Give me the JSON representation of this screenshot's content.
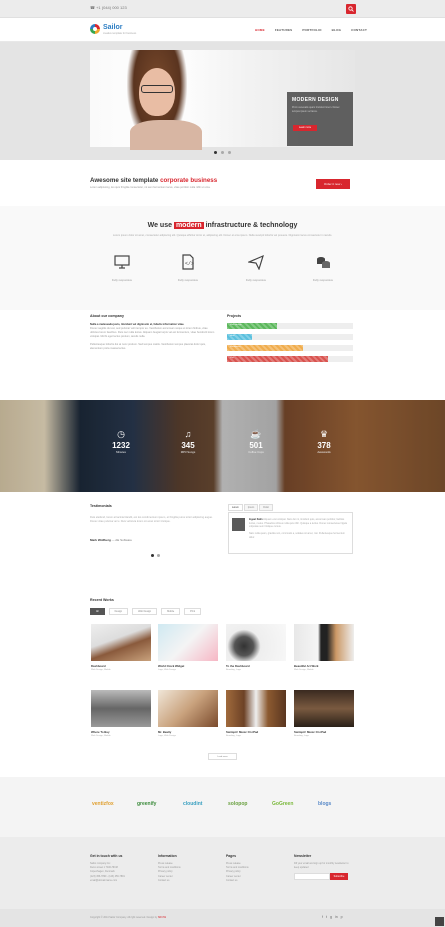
{
  "topbar": {
    "phone": "☎ +1 (044) 000 123",
    "search_icon": "search-icon"
  },
  "brand": {
    "name": "Sailor",
    "tagline": "creative template for business"
  },
  "nav": [
    "HOME",
    "FEATURES",
    "PORTFOLIO",
    "BLOG",
    "CONTACT"
  ],
  "hero": {
    "title": "MODERN DESIGN",
    "text": "Proin venenatis quam tincidunt lorem. Donec tempus ipsum vel lacus.",
    "button": "Learn more"
  },
  "promo": {
    "title_start": "Awesome site template",
    "title_highlight": "corporate business",
    "sub": "Lorem adipiscing, leo quis fringilla consectetur, mi sem fermentum lacus, vitae porttitor nulla nibh ut urna.",
    "button": "Order it now ›"
  },
  "tech": {
    "title_start": "We use",
    "title_highlight": "modern",
    "title_end": "infrastructure & technology",
    "sub": "Lorem ipsum dolor sit amet, consectetur adipiscing elit. Quisque efficitur tortor et, adipiscing elit. Donec et eros ipsum. Nulla suscipit lobortis vel posuere. Dignissim lacus consectetur in iaculis.",
    "features": [
      "Fully responsive",
      "Fully responsive",
      "Fully responsive",
      "Fully responsive"
    ]
  },
  "about": {
    "title": "About our company",
    "lead": "Nulla a malesuada justo, tincidunt vel dignissim et, fabulis information vitae.",
    "text": "Donec sagittis dui est, sed pulvinar velit tempor eu. Vestibulum accumsan neque et lorem finibus, vitae ultricies lorem faucibus. Duis nec nulla lectus. Aliquam feugiat turpis vel est fermentum, vitae hendrerit lorem volutpat. Morbi eget lectus pretium, iaculis nulla.",
    "text2": "Pellentesque lobortis dui at nunc pretium. Sed tempus mattis. Vestibulum tempus placerat dolor quis, elementum porta massa lectus."
  },
  "projects": {
    "title": "Projects",
    "bars": [
      {
        "label": "Web design",
        "value": 40,
        "color": "#5cb85c"
      },
      {
        "label": "Html",
        "value": 20,
        "color": "#5bc0de"
      },
      {
        "label": "Wordpress",
        "value": 60,
        "color": "#f0ad4e"
      },
      {
        "label": "Php",
        "value": 80,
        "color": "#d9534f"
      }
    ]
  },
  "stats": [
    {
      "icon": "clock-icon",
      "num": "1232",
      "label": "Minutes"
    },
    {
      "icon": "music-icon",
      "num": "345",
      "label": "MP3 Songs"
    },
    {
      "icon": "coffee-icon",
      "num": "501",
      "label": "Coffee Cups"
    },
    {
      "icon": "trophy-icon",
      "num": "378",
      "label": "Awwwards"
    }
  ],
  "testimonials": {
    "title": "Testimonials",
    "quote": "Duis eleifend, lorem at lacinia blandit, est leo condimentum ipsum, et fringilla purus tortor adipiscing augue. Donec vitae pulvinar arcu. Duis vehicula lorem sit amet tortor tristique.",
    "author": "Mark Wolfberg",
    "company": "AE Software",
    "tabs": [
      "Lorem",
      "Ipsum",
      "Dolor"
    ],
    "tab_name": "Ingeet Kalm",
    "tab_text": "Aliquam erat volutpat. Nam dui mi, tincidunt quis, accumsan porttitor, facilisis luctus, metus. Phasellus ultrices nulla quis nibh. Quisque a lectus. Donec consectetuer ligula vulputate sem tristique cursus.",
    "tab_text2": "Nam nulla quam, gravida non, commodo a, sodales sit amet, nisi. Pellentesque fermentum dolor."
  },
  "recent": {
    "title": "Recent Works",
    "filters": [
      "All",
      "Design",
      "Web Design",
      "Mobile",
      "Print"
    ],
    "works": [
      {
        "title": "Dashboard",
        "sub": "Web Design, Mobile"
      },
      {
        "title": "World Clock Widget",
        "sub": "Logo, Web Design"
      },
      {
        "title": "To the Dashboard",
        "sub": "Branding, Logo"
      },
      {
        "title": "Beautiful Art Work",
        "sub": "Web Design, Mobile"
      },
      {
        "title": "Where To Buy",
        "sub": "Web Design, Mobile"
      },
      {
        "title": "Mr. Beatty",
        "sub": "Logo, Web Design"
      },
      {
        "title": "Swimpin' Music On iPad",
        "sub": "Branding, Logo"
      },
      {
        "title": "Swimpin' Music On iPad",
        "sub": "Branding, Logo"
      }
    ],
    "load_more": "Load more"
  },
  "clients": [
    "ventizfox",
    "greenify",
    "cloudint",
    "solopop",
    "GoGreen",
    "blogs"
  ],
  "footer": {
    "contact": {
      "title": "Get in touch with us",
      "lines": [
        "Sailor company Inc",
        "Demo street 1 7400-HK48",
        "Copenhagen, Denmark",
        "(123) 456-7890 - (123) 456-7891",
        "email@domainname.com"
      ]
    },
    "info": {
      "title": "Information",
      "links": [
        "Press release",
        "Terms and conditions",
        "Privacy policy",
        "Career center",
        "Contact us"
      ]
    },
    "pages": {
      "title": "Pages",
      "links": [
        "Press release",
        "Terms and conditions",
        "Privacy policy",
        "Career center",
        "Contact us"
      ]
    },
    "newsletter": {
      "title": "Newsletter",
      "text": "Fill your email and sign up for monthly newsletter to keep updated",
      "button": "Subscribe"
    }
  },
  "copyright": {
    "text": "Copyright © 2014 Sailor Company. All right reserved. Design by",
    "brand": "SRCSS"
  },
  "social": [
    "f",
    "t",
    "g",
    "in",
    "p"
  ]
}
